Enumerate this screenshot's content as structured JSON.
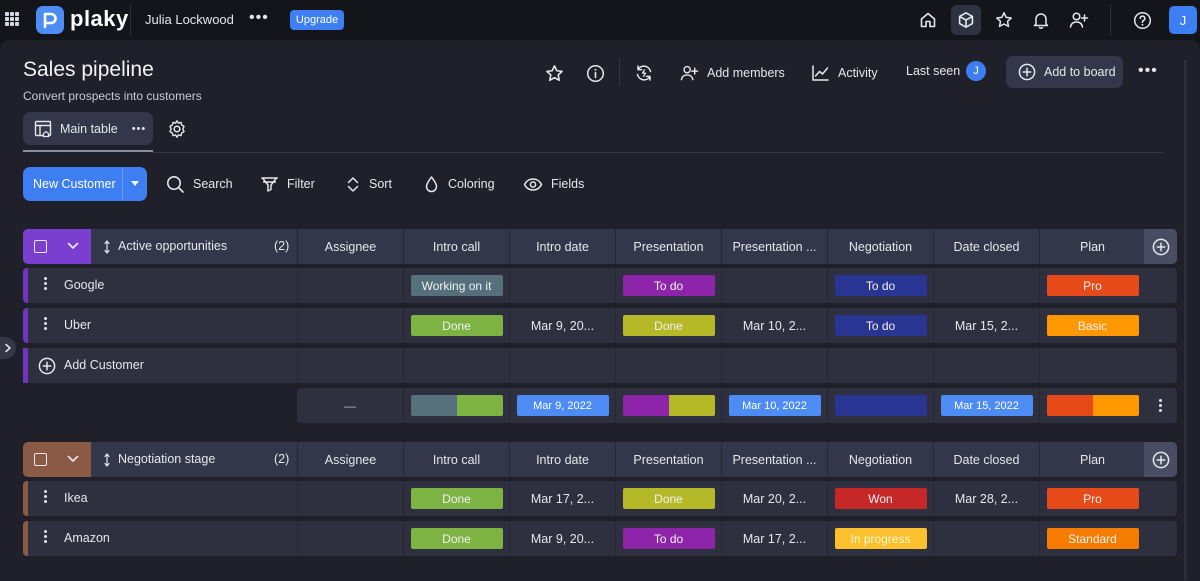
{
  "topbar": {
    "logo": "plaky",
    "workspace_user": "Julia Lockwood",
    "upgrade_label": "Upgrade",
    "avatar_initial": "J",
    "icons": [
      "home-icon",
      "box-icon",
      "star-icon",
      "bell-icon",
      "add-user-icon",
      "help-icon"
    ]
  },
  "board": {
    "title": "Sales pipeline",
    "subtitle": "Convert prospects into customers",
    "add_members_label": "Add members",
    "activity_label": "Activity",
    "last_seen_label": "Last seen",
    "last_seen_initial": "J",
    "add_to_board_label": "Add to board"
  },
  "view": {
    "main_table_label": "Main table"
  },
  "toolbar": {
    "new_button_label": "New Customer",
    "search_label": "Search",
    "filter_label": "Filter",
    "sort_label": "Sort",
    "coloring_label": "Coloring",
    "fields_label": "Fields"
  },
  "columns": [
    "Assignee",
    "Intro call",
    "Intro date",
    "Presentation",
    "Presentation ...",
    "Negotiation",
    "Date closed",
    "Plan"
  ],
  "groups": [
    {
      "name": "Active opportunities",
      "count": "(2)",
      "color": "#7b3fd0",
      "strip_color": "#6f36c2",
      "rows": [
        {
          "name": "Google",
          "intro_call": "Working on it",
          "intro_date": "",
          "presentation": "To do",
          "presentation_date": "",
          "negotiation": "To do",
          "date_closed": "",
          "plan": "Pro"
        },
        {
          "name": "Uber",
          "intro_call": "Done",
          "intro_date": "Mar 9, 20...",
          "presentation": "Done",
          "presentation_date": "Mar 10, 2...",
          "negotiation": "To do",
          "date_closed": "Mar 15, 2...",
          "plan": "Basic"
        }
      ],
      "add_row_label": "Add Customer",
      "summary": {
        "assignee": "—",
        "intro_date": "Mar 9, 2022",
        "presentation_date": "Mar 10, 2022",
        "date_closed": "Mar 15, 2022"
      }
    },
    {
      "name": "Negotiation stage",
      "count": "(2)",
      "color": "#8a5a44",
      "strip_color": "#8a5a44",
      "rows": [
        {
          "name": "Ikea",
          "intro_call": "Done",
          "intro_date": "Mar 17, 2...",
          "presentation": "Done",
          "presentation_date": "Mar 20, 2...",
          "negotiation": "Won",
          "date_closed": "Mar 28, 2...",
          "plan": "Pro"
        },
        {
          "name": "Amazon",
          "intro_call": "Done",
          "intro_date": "Mar 9, 20...",
          "presentation": "To do",
          "presentation_date": "Mar 17, 2...",
          "negotiation": "In progress",
          "date_closed": "",
          "plan": "Standard"
        }
      ]
    }
  ],
  "status_colors": {
    "Working on it": "#55707a",
    "Done": "#7cb342",
    "Done_presentation": "#b5b928",
    "To do": "#8e24aa",
    "To do_negotiation": "#283593",
    "Won": "#c62828",
    "In progress": "#fbc02d",
    "Pro": "#e64a19",
    "Basic": "#ff9800",
    "Standard": "#f57c00"
  }
}
